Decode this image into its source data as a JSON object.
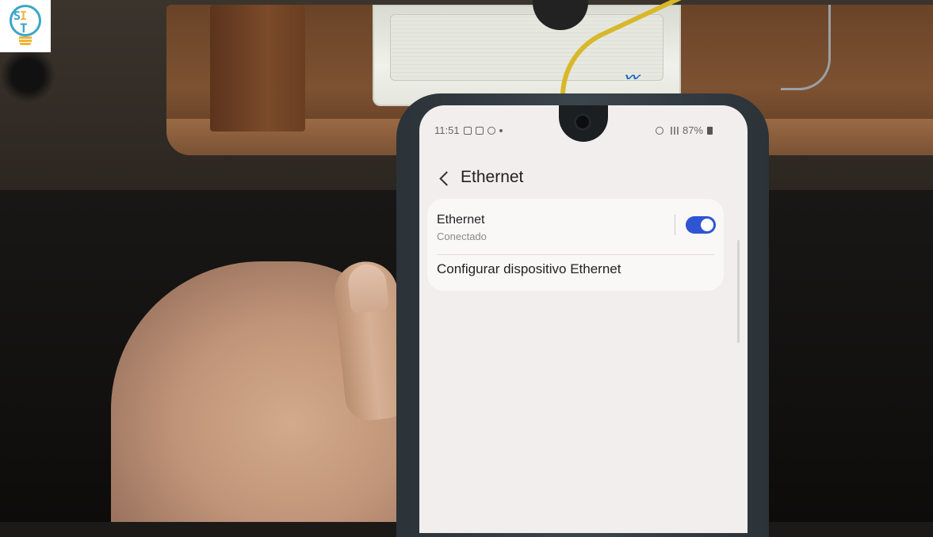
{
  "status_bar": {
    "time": "11:51",
    "battery": "87%"
  },
  "header": {
    "title": "Ethernet"
  },
  "settings": {
    "ethernet": {
      "label": "Ethernet",
      "status": "Conectado",
      "toggle_on": true
    },
    "configure": {
      "label": "Configurar dispositivo Ethernet"
    }
  },
  "colors": {
    "toggle_accent": "#2f55d4",
    "screen_background": "#f2eeee",
    "logo_primary": "#3aa6c7",
    "logo_secondary": "#f0b43a"
  },
  "logo": {
    "letters": "SIT"
  }
}
